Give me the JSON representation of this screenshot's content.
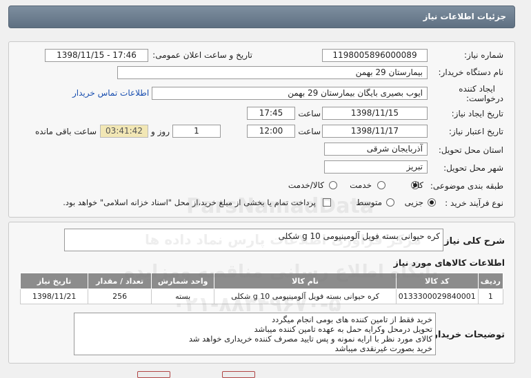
{
  "header": {
    "title": "جزئیات اطلاعات نیاز"
  },
  "form": {
    "need_number_label": "شماره نیاز:",
    "need_number": "1198005896000089",
    "announce_label": "تاریخ و ساعت اعلان عمومی:",
    "announce_value": "1398/11/15 - 17:46",
    "buyer_org_label": "نام دستگاه خریدار:",
    "buyer_org": "بیمارستان 29 بهمن",
    "creator_label_line1": "ایجاد کننده",
    "creator_label_line2": "درخواست:",
    "creator": "ایوب بصیری  بایگان بیمارستان 29 بهمن",
    "contact_link": "اطلاعات تماس خریدار",
    "created_label": "تاریخ ایجاد نیاز:",
    "created_date": "1398/11/15",
    "time_label": "ساعت",
    "created_time": "17:45",
    "validity_label": "تاریخ اعتبار نیاز:",
    "validity_date": "1398/11/17",
    "validity_time": "12:00",
    "days_value": "1",
    "days_label": "روز و",
    "remaining_value": "03:41:42",
    "remaining_label": "ساعت باقی مانده",
    "province_label": "استان محل تحویل:",
    "province": "آذربایجان شرقی",
    "city_label": "شهر محل تحویل:",
    "city": "تبریز",
    "category_label": "طبقه بندی موضوعی:",
    "category_options": [
      "کالا",
      "خدمت",
      "کالا/خدمت"
    ],
    "category_selected": "کالا",
    "process_label": "نوع فرآیند خرید :",
    "process_options": [
      "جزیی",
      "متوسط"
    ],
    "process_selected": "جزیی",
    "treasury_note": "پرداخت تمام یا بخشی از مبلغ خرید،از محل \"اسناد خزانه اسلامی\" خواهد بود."
  },
  "summary": {
    "label": "شرح کلی نیاز:",
    "text": "کره حیوانی بسته فویل آلومینیومی 10 g شکلی"
  },
  "items": {
    "title": "اطلاعات کالاهای مورد نیاز",
    "columns": [
      "ردیف",
      "کد کالا",
      "نام کالا",
      "واحد شمارش",
      "تعداد / مقدار",
      "تاریخ نیاز"
    ],
    "rows": [
      [
        "1",
        "0133300029840001",
        "کره حیوانی بسته فویل آلومینیومی 10 g شکلی",
        "بسته",
        "256",
        "1398/11/21"
      ]
    ]
  },
  "buyer_notes": {
    "label": "توضیحات خریدار:",
    "lines": [
      "خرید فقط از تامین کننده های بومی انجام میگردد",
      "تحویل درمحل وکرایه حمل به عهده تامین کننده میباشد",
      "کالای مورد نظر با ارایه نمونه و پس تایید مصرف کننده خریداری خواهد شد",
      "خرید بصورت غیرنقدی میباشد"
    ]
  },
  "watermark": {
    "line1": "ParsNamadData",
    "line2": "مرکز فراوری اطلاعات پارس نماد داده ها",
    "line3": "پایگاه اطلاع رسانی مناقصه ومزایده",
    "line4": "۰۲۱-۸۸۳۴۹۶۷۰-۵"
  }
}
